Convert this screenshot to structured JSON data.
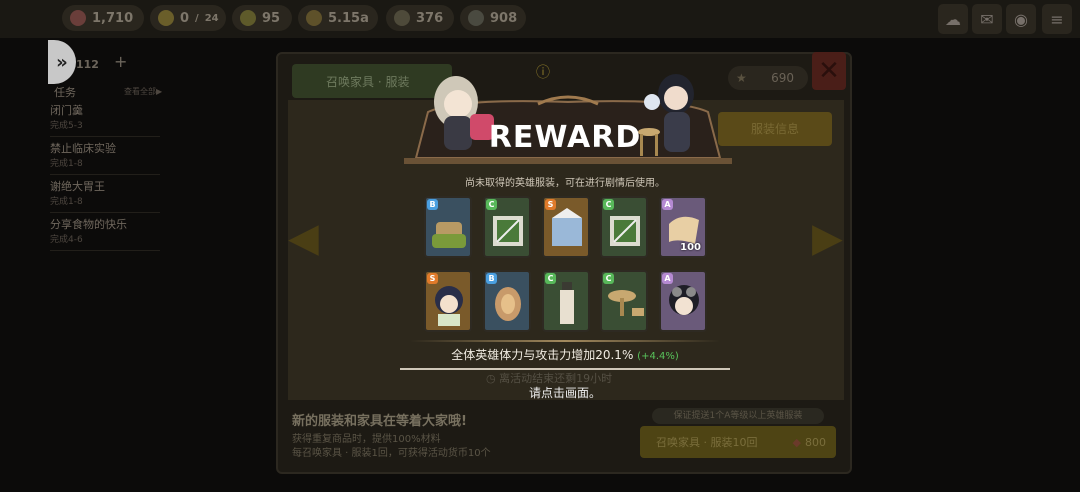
{
  "top_bar": {
    "hearts": "1,710",
    "energy": "0",
    "energy_max": "24",
    "lightning": "95",
    "gold": "5.15a",
    "resource_a": "376",
    "resource_b": "908"
  },
  "left_panel": {
    "count": "112",
    "tasks_label": "任务",
    "view_all": "查看全部▶",
    "quests": [
      {
        "name": "闭门羹",
        "status": "完成5-3"
      },
      {
        "name": "禁止临床实验",
        "status": "完成1-8"
      },
      {
        "name": "谢绝大胃王",
        "status": "完成1-8"
      },
      {
        "name": "分享食物的快乐",
        "status": "完成4-6"
      }
    ]
  },
  "shop": {
    "tab_label": "召唤家具 · 服装",
    "stars": "690",
    "right_tab": "服装信息",
    "timer": "离活动结束还剩19小时",
    "headline": "新的服装和家具在等着大家哦!",
    "line1": "获得重复商品时，提供100%材料",
    "line2": "每召唤家具 · 服装1回，可获得活动货币10个",
    "guarantee": "保证提送1个A等级以上英雄服装",
    "summon_button": "召唤家具 · 服装10回",
    "summon_cost": "800"
  },
  "reward": {
    "title": "REWARD",
    "subtitle": "尚未取得的英雄服装，可在进行剧情后使用。",
    "stat_text": "全体英雄体力与攻击力增加20.1%",
    "stat_increase": "(+4.4%)",
    "tap_hint": "请点击画面。",
    "items": [
      {
        "grade": "B",
        "icon": "sandbag-icon",
        "qty": ""
      },
      {
        "grade": "C",
        "icon": "fence-icon",
        "qty": ""
      },
      {
        "grade": "S",
        "icon": "tent-icon",
        "qty": ""
      },
      {
        "grade": "C",
        "icon": "fence-icon",
        "qty": ""
      },
      {
        "grade": "A",
        "icon": "cloth-material-icon",
        "qty": "100"
      },
      {
        "grade": "S",
        "icon": "hero-costume-portrait-icon",
        "qty": ""
      },
      {
        "grade": "B",
        "icon": "log-slice-icon",
        "qty": ""
      },
      {
        "grade": "C",
        "icon": "lamp-post-icon",
        "qty": ""
      },
      {
        "grade": "C",
        "icon": "table-stool-icon",
        "qty": ""
      },
      {
        "grade": "A",
        "icon": "hero-goggles-portrait-icon",
        "qty": ""
      }
    ],
    "colors": {
      "A": "#b58ad2",
      "B": "#4a9fe0",
      "C": "#58b85a",
      "S": "#e07a2a"
    }
  }
}
